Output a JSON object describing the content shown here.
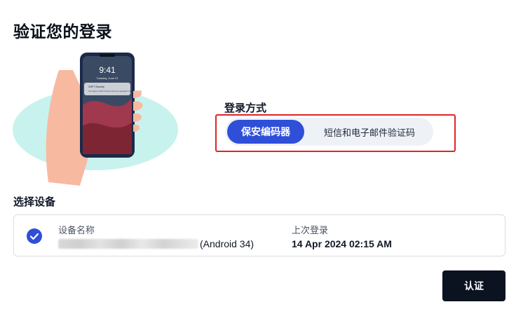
{
  "page": {
    "title": "验证您的登录"
  },
  "illustration": {
    "phone_time": "9:41",
    "phone_date": "Tuesday, June 21",
    "notification_title": "CNFT Security",
    "notification_body": "Your login to CNFT Security has been requested. Click to approve."
  },
  "login_method": {
    "label": "登录方式",
    "options": [
      {
        "label": "保安编码器",
        "selected": true
      },
      {
        "label": "短信和电子邮件验证码",
        "selected": false
      }
    ]
  },
  "device_section": {
    "label": "选择设备",
    "columns": {
      "name_header": "设备名称",
      "last_login_header": "上次登录"
    },
    "device": {
      "name_visible": "(Android 34)",
      "last_login": "14 Apr 2024 02:15 AM",
      "selected": true
    }
  },
  "actions": {
    "verify_label": "认证"
  },
  "colors": {
    "accent": "#2f4fd8",
    "highlight": "#e02424",
    "primary_button": "#0b1220"
  }
}
